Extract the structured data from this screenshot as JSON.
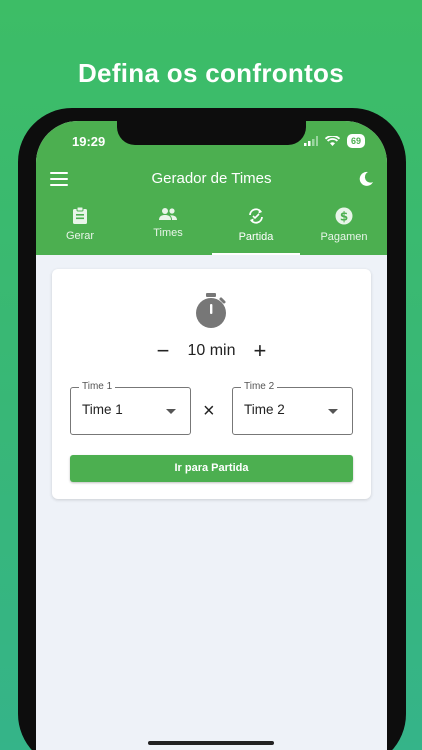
{
  "headline": "Defina os confrontos",
  "status": {
    "time": "19:29",
    "battery": "69"
  },
  "appbar": {
    "title": "Gerador de Times"
  },
  "tabs": [
    {
      "label": "Gerar",
      "icon": "clipboard-icon"
    },
    {
      "label": "Times",
      "icon": "people-icon"
    },
    {
      "label": "Partida",
      "icon": "swap-icon",
      "active": true
    },
    {
      "label": "Pagamen",
      "icon": "dollar-icon"
    }
  ],
  "match": {
    "duration": "10 min",
    "minus": "−",
    "plus": "+",
    "team1": {
      "legend": "Time 1",
      "value": "Time 1"
    },
    "vs": "×",
    "team2": {
      "legend": "Time 2",
      "value": "Time 2"
    },
    "go_label": "Ir para Partida"
  },
  "colors": {
    "accent": "#4caf50",
    "background": "#eef2f8"
  }
}
